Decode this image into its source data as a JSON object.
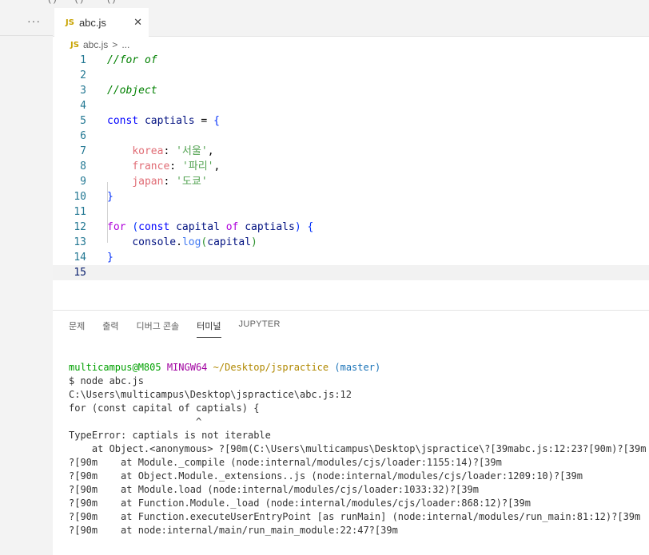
{
  "menu": {
    "partial_text": "· · · ( ) · · · ( ) · · · · ( ) · · ·"
  },
  "sidebar": {
    "more": "···"
  },
  "tab": {
    "icon": "JS",
    "label": "abc.js",
    "close": "✕"
  },
  "breadcrumb": {
    "icon": "JS",
    "file": "abc.js",
    "sep": ">",
    "more": "..."
  },
  "editor": {
    "line_numbers": [
      "1",
      "2",
      "3",
      "4",
      "5",
      "6",
      "7",
      "8",
      "9",
      "10",
      "11",
      "12",
      "13",
      "14",
      "15"
    ],
    "current_line": "15"
  },
  "code": {
    "l1": "//for of",
    "l3": "//object",
    "l5_kw": "const",
    "l5_name": "captials",
    "l5_eq": " = ",
    "l5_brace": "{",
    "l7_key": "korea",
    "l7_colon": ": ",
    "l7_val": "'서울'",
    "l7_comma": ",",
    "l8_key": "france",
    "l8_colon": ": ",
    "l8_val": "'파리'",
    "l8_comma": ",",
    "l9_key": "japan",
    "l9_colon": ": ",
    "l9_val": "'도쿄'",
    "l10_brace": "}",
    "l12_for": "for",
    "l12_paren_open": "(",
    "l12_const": "const",
    "l12_capital": "capital",
    "l12_of": "of",
    "l12_captials": "captials",
    "l12_paren_close": ")",
    "l12_brace": "{",
    "l13_console": "console",
    "l13_dot": ".",
    "l13_log": "log",
    "l13_paren_open": "(",
    "l13_capital": "capital",
    "l13_paren_close": ")",
    "l14_brace": "}"
  },
  "panel": {
    "tabs": [
      "문제",
      "출력",
      "디버그 콘솔",
      "터미널",
      "JUPYTER"
    ],
    "active_tab": "터미널"
  },
  "terminal": {
    "prompt_user": "multicampus@M805",
    "prompt_env": "MINGW64",
    "prompt_path": "~/Desktop/jspractice",
    "prompt_branch": "(master)",
    "lines": [
      "$ node abc.js",
      "C:\\Users\\multicampus\\Desktop\\jspractice\\abc.js:12",
      "for (const capital of captials) {",
      "                      ^",
      "",
      "TypeError: captials is not iterable",
      "    at Object.<anonymous> ?[90m(C:\\Users\\multicampus\\Desktop\\jspractice\\?[39mabc.js:12:23?[90m)?[39m",
      "?[90m    at Module._compile (node:internal/modules/cjs/loader:1155:14)?[39m",
      "?[90m    at Object.Module._extensions..js (node:internal/modules/cjs/loader:1209:10)?[39m",
      "?[90m    at Module.load (node:internal/modules/cjs/loader:1033:32)?[39m",
      "?[90m    at Function.Module._load (node:internal/modules/cjs/loader:868:12)?[39m",
      "?[90m    at Function.executeUserEntryPoint [as runMain] (node:internal/modules/run_main:81:12)?[39m",
      "?[90m    at node:internal/main/run_main_module:22:47?[39m"
    ]
  }
}
